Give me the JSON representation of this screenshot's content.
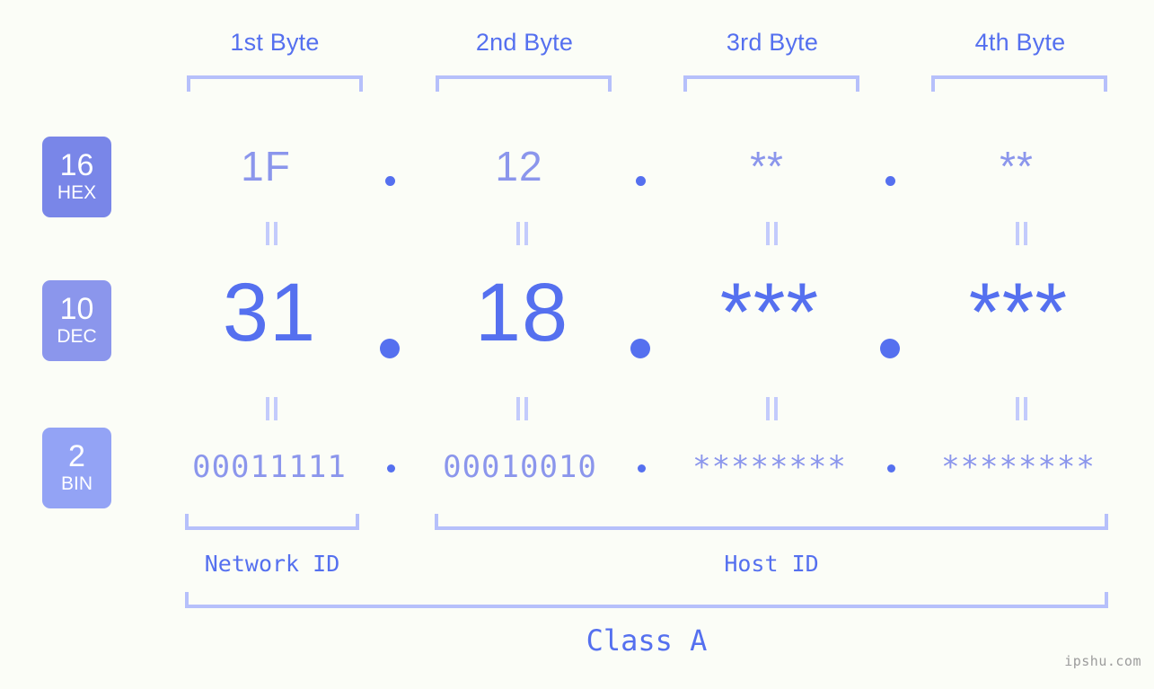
{
  "meta": {
    "watermark": "ipshu.com",
    "background_color": "#fbfdf7",
    "accent_strong": "#5570ef",
    "accent_mid": "#8b96ec",
    "accent_light": "#b6c0fb"
  },
  "byte_headers": [
    {
      "label": "1st Byte"
    },
    {
      "label": "2nd Byte"
    },
    {
      "label": "3rd Byte"
    },
    {
      "label": "4th Byte"
    }
  ],
  "radix_rows": [
    {
      "badge_number": "16",
      "badge_name": "HEX",
      "badge_color": "#7986e8",
      "values": [
        "1F",
        "12",
        "**",
        "**"
      ],
      "separator": "."
    },
    {
      "badge_number": "10",
      "badge_name": "DEC",
      "badge_color": "#8b96ec",
      "values": [
        "31",
        "18",
        "***",
        "***"
      ],
      "separator": "."
    },
    {
      "badge_number": "2",
      "badge_name": "BIN",
      "badge_color": "#93a3f5",
      "values": [
        "00011111",
        "00010010",
        "********",
        "********"
      ],
      "separator": "."
    }
  ],
  "equality_marks": {
    "glyph": "=",
    "count_per_gap": 4
  },
  "id_sections": [
    {
      "label": "Network ID"
    },
    {
      "label": "Host ID"
    }
  ],
  "class_section": {
    "label": "Class A"
  }
}
